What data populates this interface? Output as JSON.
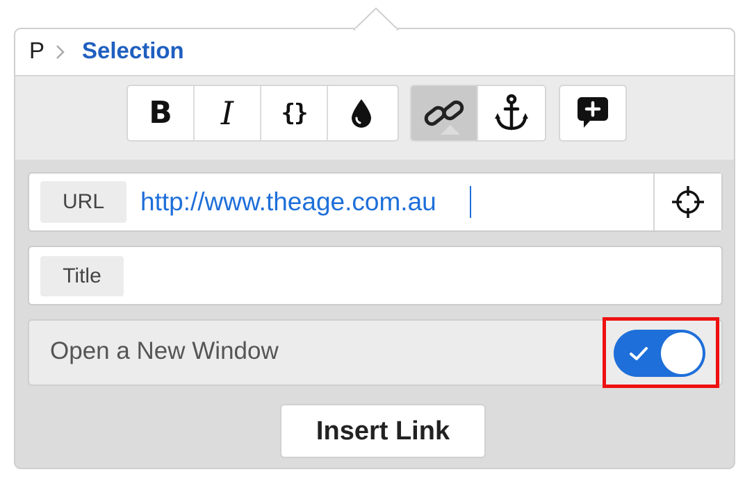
{
  "breadcrumb": {
    "parent": "P",
    "separator_icon": "chevron-right-icon",
    "current": "Selection"
  },
  "toolbar": {
    "groups": [
      [
        {
          "icon": "bold-icon",
          "glyph": "B"
        },
        {
          "icon": "italic-icon",
          "glyph": "I"
        },
        {
          "icon": "code-braces-icon",
          "glyph": "{}"
        },
        {
          "icon": "color-drop-icon"
        }
      ],
      [
        {
          "icon": "link-icon",
          "active": true
        },
        {
          "icon": "anchor-icon"
        }
      ],
      [
        {
          "icon": "comment-add-icon"
        }
      ]
    ]
  },
  "link_form": {
    "url": {
      "label": "URL",
      "value": "http://www.theage.com.au",
      "target_icon": "crosshair-icon"
    },
    "title": {
      "label": "Title",
      "value": ""
    },
    "new_window": {
      "label": "Open a New Window",
      "checked": true,
      "check_icon": "check-icon"
    },
    "submit_label": "Insert Link"
  },
  "colors": {
    "accent": "#1e6fd9",
    "breadcrumb_current": "#1f5fbf",
    "highlight": "#ee1111",
    "active_tool": "#c9c9c9"
  }
}
